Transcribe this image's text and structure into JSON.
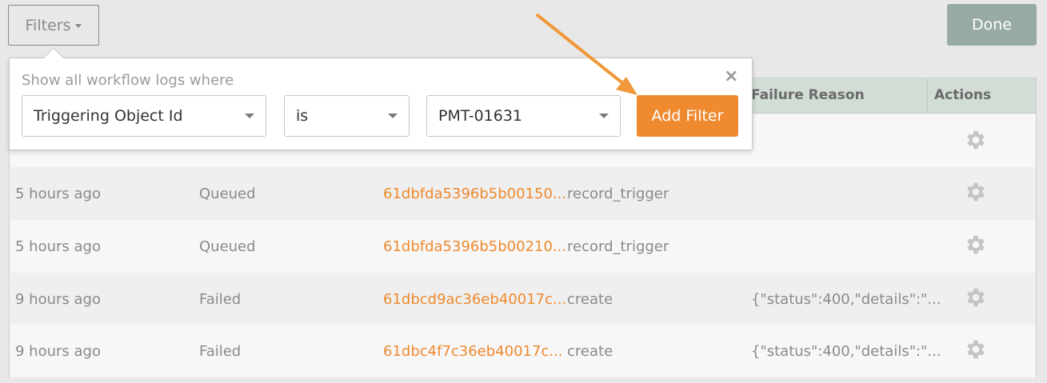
{
  "toolbar": {
    "filters_label": "Filters",
    "done_label": "Done"
  },
  "filter_popover": {
    "title": "Show all workflow logs where",
    "field_value": "Triggering Object Id",
    "operator_value": "is",
    "value_value": "PMT-01631",
    "add_filter_label": "Add Filter",
    "close_label": "×"
  },
  "table": {
    "headers": {
      "failure_reason": "Failure Reason",
      "actions": "Actions"
    },
    "rows": [
      {
        "time": "5 hours ago",
        "status": "Queued",
        "id": "61dbfda5396b5b00150...",
        "action": "record_trigger",
        "failure": ""
      },
      {
        "time": "5 hours ago",
        "status": "Queued",
        "id": "61dbfda5396b5b00210...",
        "action": "record_trigger",
        "failure": ""
      },
      {
        "time": "9 hours ago",
        "status": "Failed",
        "id": "61dbcd9ac36eb40017c...",
        "action": "create",
        "failure": "{\"status\":400,\"details\":\"..."
      },
      {
        "time": "9 hours ago",
        "status": "Failed",
        "id": "61dbc4f7c36eb40017c...",
        "action": "create",
        "failure": "{\"status\":400,\"details\":\"..."
      }
    ]
  },
  "colors": {
    "accent": "#f08a30",
    "done_button": "#97aba4",
    "header_bg": "#d2ddd6"
  },
  "icons": {
    "gear": "gear-icon",
    "close": "close-icon",
    "caret": "chevron-down-icon",
    "annotation_arrow": "arrow-annotation"
  }
}
